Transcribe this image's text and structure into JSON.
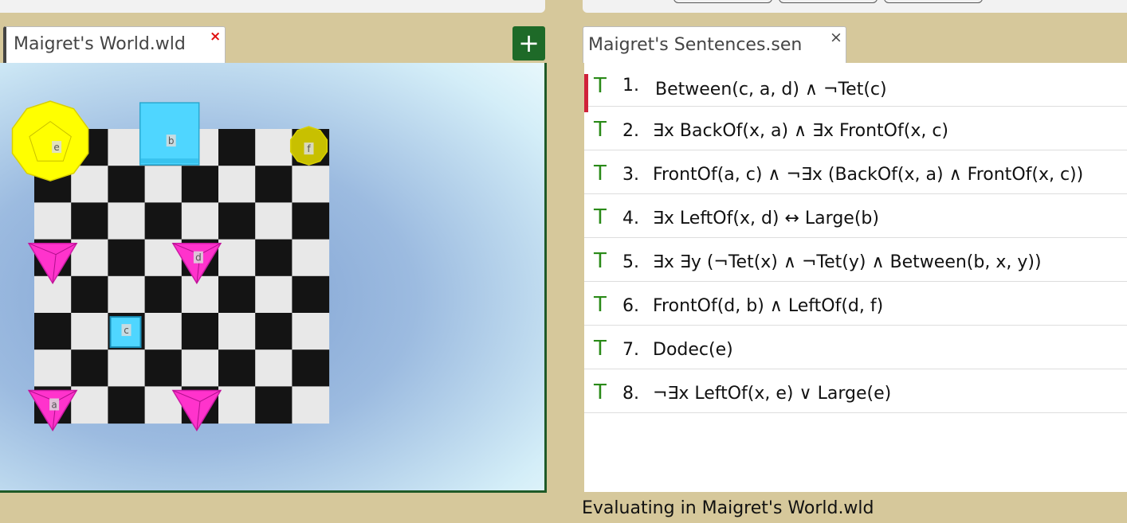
{
  "world_tab": {
    "title": "Maigret's World.wld",
    "close": "×"
  },
  "add_button": {
    "label": "+"
  },
  "sentences_tab": {
    "title": "Maigret's Sentences.sen",
    "close": "×"
  },
  "world": {
    "grid_size": 8,
    "objects": [
      {
        "label": "e",
        "shape": "dodec",
        "size": "large",
        "col": 0,
        "row": 0,
        "color": "#ffff00"
      },
      {
        "label": "b",
        "shape": "cube",
        "size": "large",
        "col": 3,
        "row": 0,
        "color": "#4fd6ff"
      },
      {
        "label": "f",
        "shape": "dodec",
        "size": "small",
        "col": 7,
        "row": 0,
        "color": "#c8c000"
      },
      {
        "label": "",
        "shape": "tet",
        "size": "medium",
        "col": 0,
        "row": 3,
        "color": "#ff33cc"
      },
      {
        "label": "d",
        "shape": "tet",
        "size": "medium",
        "col": 4,
        "row": 3,
        "color": "#ff33cc"
      },
      {
        "label": "c",
        "shape": "cube",
        "size": "small",
        "col": 2,
        "row": 5,
        "color": "#4fd6ff"
      },
      {
        "label": "a",
        "shape": "tet",
        "size": "medium",
        "col": 0,
        "row": 7,
        "color": "#ff33cc"
      },
      {
        "label": "",
        "shape": "tet",
        "size": "medium",
        "col": 4,
        "row": 7,
        "color": "#ff33cc"
      }
    ]
  },
  "sentences": [
    {
      "truth": "T",
      "num": "1.",
      "formula": "Between(c, a, d) ∧ ¬Tet(c)"
    },
    {
      "truth": "T",
      "num": "2.",
      "formula": "∃x BackOf(x, a) ∧ ∃x FrontOf(x, c)"
    },
    {
      "truth": "T",
      "num": "3.",
      "formula": "FrontOf(a, c) ∧ ¬∃x (BackOf(x, a) ∧ FrontOf(x, c))"
    },
    {
      "truth": "T",
      "num": "4.",
      "formula": "∃x LeftOf(x, d) ↔ Large(b)"
    },
    {
      "truth": "T",
      "num": "5.",
      "formula": "∃x ∃y (¬Tet(x) ∧ ¬Tet(y) ∧ Between(b, x, y))"
    },
    {
      "truth": "T",
      "num": "6.",
      "formula": "FrontOf(d, b) ∧ LeftOf(d, f)"
    },
    {
      "truth": "T",
      "num": "7.",
      "formula": "Dodec(e)"
    },
    {
      "truth": "T",
      "num": "8.",
      "formula": "¬∃x LeftOf(x, e) ∨ Large(e)"
    }
  ],
  "status": {
    "text": "Evaluating in Maigret's World.wld"
  }
}
